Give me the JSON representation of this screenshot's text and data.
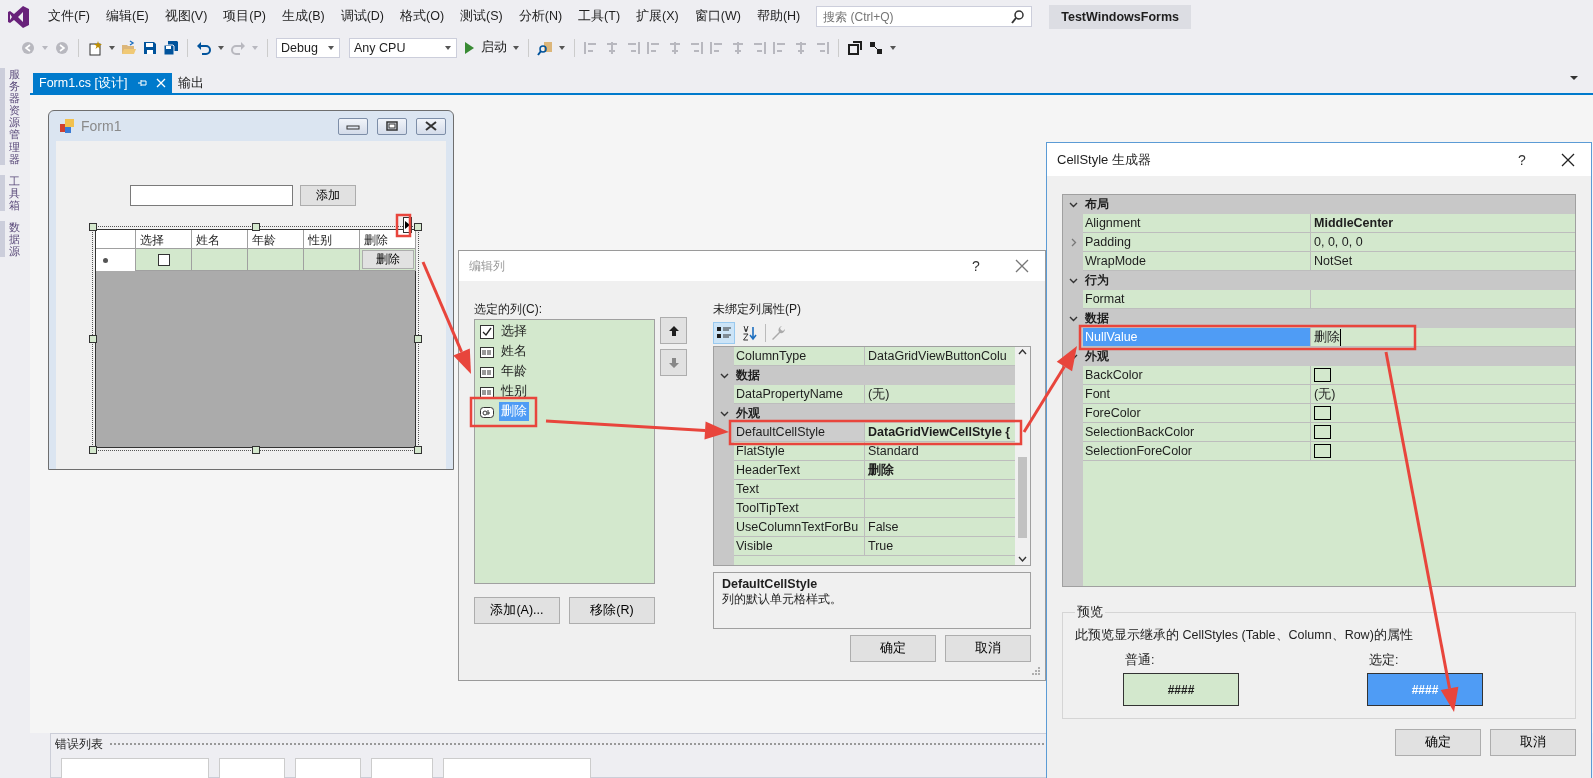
{
  "menu_bar": {
    "items": [
      "文件(F)",
      "编辑(E)",
      "视图(V)",
      "项目(P)",
      "生成(B)",
      "调试(D)",
      "格式(O)",
      "测试(S)",
      "分析(N)",
      "工具(T)",
      "扩展(X)",
      "窗口(W)",
      "帮助(H)"
    ],
    "search": {
      "placeholder": "搜索 (Ctrl+Q)"
    },
    "solution_name": "TestWindowsForms"
  },
  "toolbar": {
    "configuration": "Debug",
    "platform": "Any CPU",
    "start": "启动"
  },
  "side_tabs": [
    {
      "label": "服务器资源管理器"
    },
    {
      "label": "工具箱"
    },
    {
      "label": "数据源"
    }
  ],
  "document_tabs": [
    {
      "label": "Form1.cs [设计]",
      "selected": true
    },
    {
      "label": "输出",
      "selected": false
    }
  ],
  "form1": {
    "title": "Form1",
    "add_button": "添加",
    "grid": {
      "columns": [
        "选择",
        "姓名",
        "年龄",
        "性别",
        "删除"
      ],
      "new_row": {
        "checked": false,
        "button_label": "删除"
      }
    }
  },
  "edit_columns_dialog": {
    "title": "编辑列",
    "help": "?",
    "selected_columns_label": "选定的列(C):",
    "columns": [
      {
        "kind": "checkbox",
        "label": "选择",
        "selected": false
      },
      {
        "kind": "textbox",
        "label": "姓名",
        "selected": false
      },
      {
        "kind": "textbox",
        "label": "年龄",
        "selected": false
      },
      {
        "kind": "textbox",
        "label": "性别",
        "selected": false
      },
      {
        "kind": "button",
        "label": "删除",
        "selected": true
      }
    ],
    "add_button": "添加(A)...",
    "remove_button": "移除(R)",
    "properties_label": "未绑定列属性(P)",
    "view_buttons": [
      {
        "kind": "categorized",
        "selected": true
      },
      {
        "kind": "alphabetical",
        "selected": false
      }
    ],
    "property_grid": {
      "focused": false,
      "rows": [
        {
          "kind": "property",
          "name": "ColumnType",
          "value": "DataGridViewButtonColu",
          "selected": false
        },
        {
          "kind": "category",
          "name": "数据",
          "expanded": true
        },
        {
          "kind": "property",
          "name": "DataPropertyName",
          "value": "(无)",
          "selected": false
        },
        {
          "kind": "category",
          "name": "外观",
          "expanded": true
        },
        {
          "kind": "property",
          "name": "DefaultCellStyle",
          "value": "DataGridViewCellStyle {",
          "bold": true,
          "selected": true
        },
        {
          "kind": "property",
          "name": "FlatStyle",
          "value": "Standard",
          "selected": false
        },
        {
          "kind": "property",
          "name": "HeaderText",
          "value": "删除",
          "bold": true,
          "selected": false
        },
        {
          "kind": "property",
          "name": "Text",
          "selected": false
        },
        {
          "kind": "property",
          "name": "ToolTipText",
          "selected": false
        },
        {
          "kind": "property",
          "name": "UseColumnTextForBu",
          "value": "False",
          "selected": false
        },
        {
          "kind": "property",
          "name": "Visible",
          "value": "True",
          "selected": false
        }
      ]
    },
    "description": {
      "title": "DefaultCellStyle",
      "text": "列的默认单元格样式。"
    },
    "ok_button": "确定",
    "cancel_button": "取消"
  },
  "cellstyle_dialog": {
    "title": "CellStyle 生成器",
    "help": "?",
    "property_grid": {
      "focused": true,
      "rows": [
        {
          "kind": "category",
          "name": "布局",
          "expanded": true
        },
        {
          "kind": "property",
          "name": "Alignment",
          "value": "MiddleCenter",
          "bold": true,
          "selected": false
        },
        {
          "kind": "property",
          "name": "Padding",
          "value": "0, 0, 0, 0",
          "expandable": true,
          "expanded": false,
          "selected": false
        },
        {
          "kind": "property",
          "name": "WrapMode",
          "value": "NotSet",
          "selected": false
        },
        {
          "kind": "category",
          "name": "行为",
          "expanded": true
        },
        {
          "kind": "property",
          "name": "Format",
          "selected": false
        },
        {
          "kind": "category",
          "name": "数据",
          "expanded": true
        },
        {
          "kind": "property",
          "name": "NullValue",
          "value": "删除",
          "editing": true,
          "selected": true
        },
        {
          "kind": "category",
          "name": "外观",
          "expanded": true
        },
        {
          "kind": "swatch",
          "name": "BackColor",
          "selected": false
        },
        {
          "kind": "property",
          "name": "Font",
          "value": "(无)",
          "selected": false
        },
        {
          "kind": "swatch",
          "name": "ForeColor",
          "selected": false
        },
        {
          "kind": "swatch",
          "name": "SelectionBackColor",
          "selected": false
        },
        {
          "kind": "swatch",
          "name": "SelectionForeColor",
          "selected": false
        }
      ]
    },
    "preview": {
      "title": "预览",
      "text": "此预览显示继承的 CellStyles (Table、Column、Row)的属性",
      "normal_label": "普通:",
      "normal_sample": "####",
      "selected_label": "选定:",
      "selected_sample": "####"
    },
    "ok_button": "确定",
    "cancel_button": "取消"
  },
  "error_list": {
    "title": "错误列表"
  }
}
